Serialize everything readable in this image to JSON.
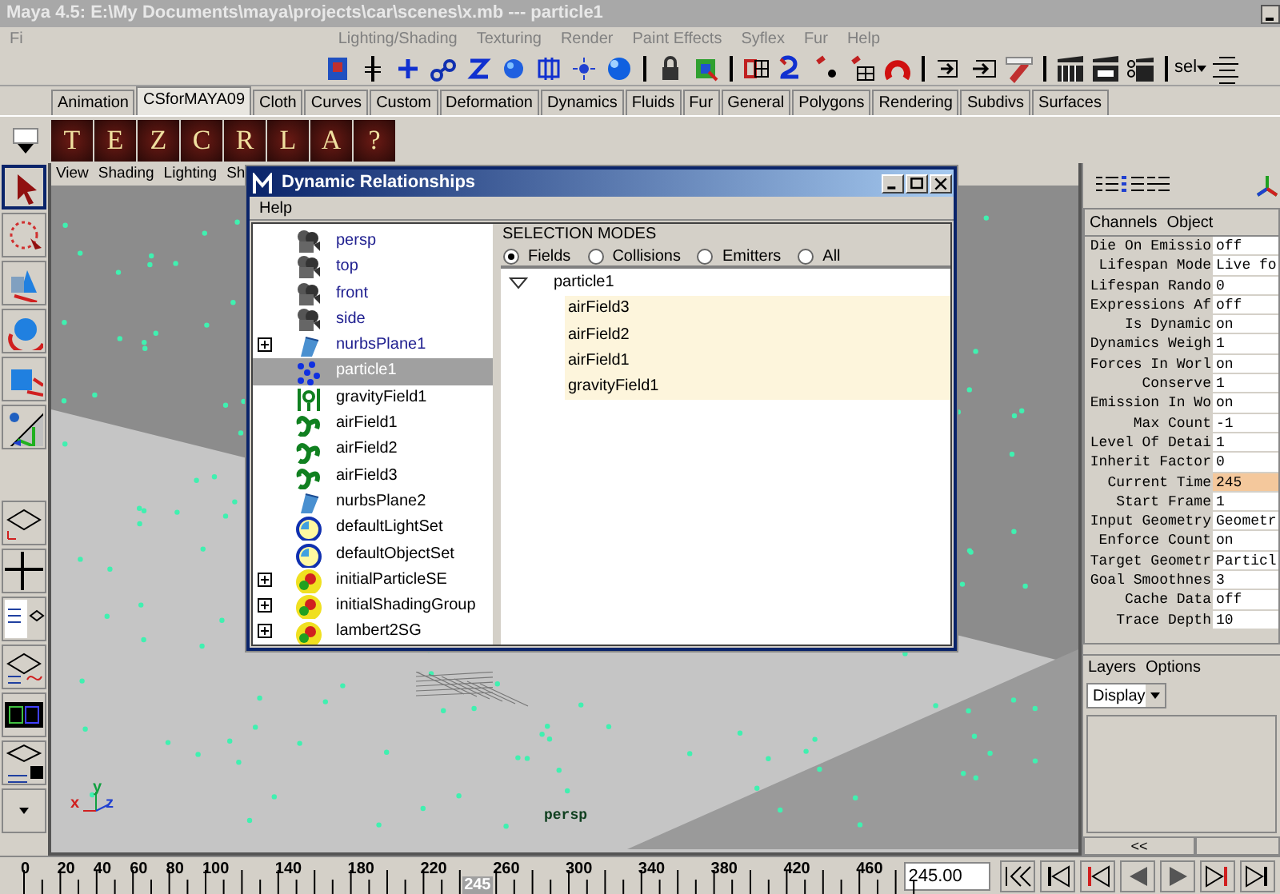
{
  "window": {
    "title": "Maya 4.5: E:\\My Documents\\maya\\projects\\car\\scenes\\x.mb  ---  particle1"
  },
  "menu_bar": [
    "Fi",
    "Lighting/Shading",
    "Texturing",
    "Render",
    "Paint Effects",
    "Syflex",
    "Fur",
    "Help"
  ],
  "status_line": {
    "selection_label": "sel"
  },
  "shelf_tabs": [
    {
      "label": "Animation",
      "selected": false
    },
    {
      "label": "CSforMAYA09",
      "selected": true
    },
    {
      "label": "Cloth",
      "selected": false
    },
    {
      "label": "Curves",
      "selected": false
    },
    {
      "label": "Custom",
      "selected": false
    },
    {
      "label": "Deformation",
      "selected": false
    },
    {
      "label": "Dynamics",
      "selected": false
    },
    {
      "label": "Fluids",
      "selected": false
    },
    {
      "label": "Fur",
      "selected": false
    },
    {
      "label": "General",
      "selected": false
    },
    {
      "label": "Polygons",
      "selected": false
    },
    {
      "label": "Rendering",
      "selected": false
    },
    {
      "label": "Subdivs",
      "selected": false
    },
    {
      "label": "Surfaces",
      "selected": false
    }
  ],
  "shelf_buttons": [
    "T",
    "E",
    "Z",
    "C",
    "R",
    "L",
    "A",
    "?"
  ],
  "viewport": {
    "menu": [
      "View",
      "Shading",
      "Lighting",
      "Sh"
    ],
    "camera_label": "persp",
    "axes": [
      "x",
      "y",
      "z"
    ]
  },
  "dialog": {
    "title": "Dynamic Relationships",
    "menu": [
      "Help"
    ],
    "outliner": [
      {
        "label": "persp",
        "kind": "camera",
        "expandable": false,
        "selected": false,
        "disabled": true
      },
      {
        "label": "top",
        "kind": "camera",
        "expandable": false,
        "selected": false,
        "disabled": true
      },
      {
        "label": "front",
        "kind": "camera",
        "expandable": false,
        "selected": false,
        "disabled": true
      },
      {
        "label": "side",
        "kind": "camera",
        "expandable": false,
        "selected": false,
        "disabled": true
      },
      {
        "label": "nurbsPlane1",
        "kind": "nurbs",
        "expandable": true,
        "selected": false,
        "disabled": true
      },
      {
        "label": "particle1",
        "kind": "particle",
        "expandable": false,
        "selected": true,
        "disabled": false
      },
      {
        "label": "gravityField1",
        "kind": "gravity",
        "expandable": false,
        "selected": false,
        "disabled": false
      },
      {
        "label": "airField1",
        "kind": "air",
        "expandable": false,
        "selected": false,
        "disabled": false
      },
      {
        "label": "airField2",
        "kind": "air",
        "expandable": false,
        "selected": false,
        "disabled": false
      },
      {
        "label": "airField3",
        "kind": "air",
        "expandable": false,
        "selected": false,
        "disabled": false
      },
      {
        "label": "nurbsPlane2",
        "kind": "nurbs",
        "expandable": false,
        "selected": false,
        "disabled": false
      },
      {
        "label": "defaultLightSet",
        "kind": "set",
        "expandable": false,
        "selected": false,
        "disabled": false
      },
      {
        "label": "defaultObjectSet",
        "kind": "set",
        "expandable": false,
        "selected": false,
        "disabled": false
      },
      {
        "label": "initialParticleSE",
        "kind": "shading",
        "expandable": true,
        "selected": false,
        "disabled": false
      },
      {
        "label": "initialShadingGroup",
        "kind": "shading",
        "expandable": true,
        "selected": false,
        "disabled": false
      },
      {
        "label": "lambert2SG",
        "kind": "shading",
        "expandable": true,
        "selected": false,
        "disabled": false
      }
    ],
    "selection_modes": {
      "title": "SELECTION MODES",
      "options": [
        {
          "label": "Fields",
          "selected": true
        },
        {
          "label": "Collisions",
          "selected": false
        },
        {
          "label": "Emitters",
          "selected": false
        },
        {
          "label": "All",
          "selected": false
        }
      ]
    },
    "connections": {
      "label": "particle1",
      "expanded": true,
      "children": [
        {
          "label": "airField3",
          "highlighted": true
        },
        {
          "label": "airField2",
          "highlighted": true
        },
        {
          "label": "airField1",
          "highlighted": true
        },
        {
          "label": "gravityField1",
          "highlighted": true
        }
      ]
    }
  },
  "channel_box": {
    "menu": [
      "Channels",
      "Object"
    ],
    "attributes": [
      {
        "name": "Die On Emissio",
        "value": "off",
        "connected": false
      },
      {
        "name": "Lifespan Mode",
        "value": "Live fo",
        "connected": false
      },
      {
        "name": "Lifespan Rando",
        "value": "0",
        "connected": false
      },
      {
        "name": "Expressions Af",
        "value": "off",
        "connected": false
      },
      {
        "name": "Is Dynamic",
        "value": "on",
        "connected": false
      },
      {
        "name": "Dynamics Weigh",
        "value": "1",
        "connected": false
      },
      {
        "name": "Forces In Worl",
        "value": "on",
        "connected": false
      },
      {
        "name": "Conserve",
        "value": "1",
        "connected": false
      },
      {
        "name": "Emission In Wo",
        "value": "on",
        "connected": false
      },
      {
        "name": "Max Count",
        "value": "-1",
        "connected": false
      },
      {
        "name": "Level Of Detai",
        "value": "1",
        "connected": false
      },
      {
        "name": "Inherit Factor",
        "value": "0",
        "connected": false
      },
      {
        "name": "Current Time",
        "value": "245",
        "connected": true
      },
      {
        "name": "Start Frame",
        "value": "1",
        "connected": false
      },
      {
        "name": "Input Geometry",
        "value": "Geometr",
        "connected": false
      },
      {
        "name": "Enforce Count",
        "value": "on",
        "connected": false
      },
      {
        "name": "Target Geometr",
        "value": "Particl",
        "connected": false
      },
      {
        "name": "Goal Smoothnes",
        "value": "3",
        "connected": false
      },
      {
        "name": "Cache Data",
        "value": "off",
        "connected": false
      },
      {
        "name": "Trace Depth",
        "value": "10",
        "connected": false
      }
    ]
  },
  "layers": {
    "menu": [
      "Layers",
      "Options"
    ],
    "display": "Display",
    "scroll_left": "<<"
  },
  "timeline": {
    "ticks": [
      "0",
      "20",
      "40",
      "60",
      "80",
      "100",
      "140",
      "180",
      "220",
      "260",
      "300",
      "340",
      "380",
      "420",
      "460"
    ],
    "current": "245",
    "current_frame": "245.00"
  }
}
